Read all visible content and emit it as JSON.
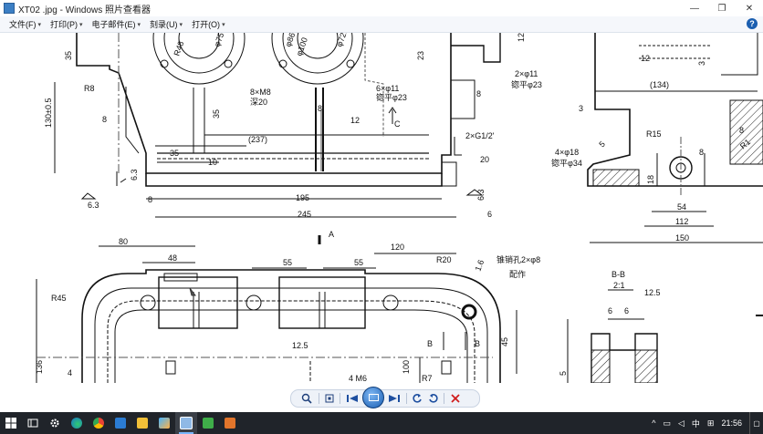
{
  "window": {
    "title": "XT02 .jpg - Windows 照片查看器",
    "minimize_glyph": "—",
    "restore_glyph": "❐",
    "close_glyph": "✕"
  },
  "menu": [
    {
      "label": "文件(F)"
    },
    {
      "label": "打印(P)"
    },
    {
      "label": "电子邮件(E)"
    },
    {
      "label": "刻录(U)"
    },
    {
      "label": "打开(O)"
    }
  ],
  "menu_chevron": "▾",
  "help_label": "?",
  "drawing": {
    "dims": {
      "r8": "R8",
      "r48": "R48",
      "phi75": "φ75",
      "phi86": "φ86",
      "phi100": "φ100",
      "phi72h7": "φ72H7",
      "d35_top": "35",
      "d130": "130±0.5",
      "d8_left": "8",
      "d35_mid": "35",
      "bolt": "8×M8",
      "deep20": "深20",
      "d8_mid": "8",
      "d12_mid": "12",
      "d237": "(237)",
      "d35_low": "35",
      "d10": "10",
      "d63_l": "6.3",
      "d8_low": "8",
      "d195": "195",
      "d245": "245",
      "d6": "6",
      "d63_r": "6.3",
      "d63_c": "6.3",
      "holes6": "6×φ11",
      "cb23": "锪平φ23",
      "c_label": "C",
      "d8_right": "8",
      "d23": "23",
      "d12_top": "12",
      "holes2": "2×φ11",
      "cb23b": "锪平φ23",
      "g12": "2×G1/2'",
      "d20": "20",
      "sec_a": "A",
      "d12_r": "12",
      "d3_r": "3",
      "d134": "(134)",
      "d3_r2": "3",
      "r15": "R15",
      "d8_rr": "8",
      "r1": "R1",
      "holes4": "4×φ18",
      "cb34": "锪平φ34",
      "d5": "5",
      "d18": "18",
      "d54": "54",
      "d8_rb": "8",
      "d112": "112",
      "d150": "150",
      "d80": "80",
      "d48": "48",
      "d120": "120",
      "d55a": "55",
      "d55b": "55",
      "r20": "R20",
      "taper": "锥销孔2×φ8",
      "pei": "配作",
      "d16": "1.6",
      "r45": "R45",
      "d136": "136",
      "d125": "12.5",
      "d4": "4",
      "d100": "100",
      "b_left": "B",
      "b_right": "B",
      "d45": "45",
      "r7": "R7",
      "lbl_l": "4 M6",
      "bb": "B-B",
      "scale": "2:1",
      "ra125": "12.5",
      "bb6a": "6",
      "bb6b": "6",
      "d5b": "5"
    }
  },
  "taskbar": {
    "clock": "21:56",
    "ime": "中",
    "tray_up": "^"
  }
}
